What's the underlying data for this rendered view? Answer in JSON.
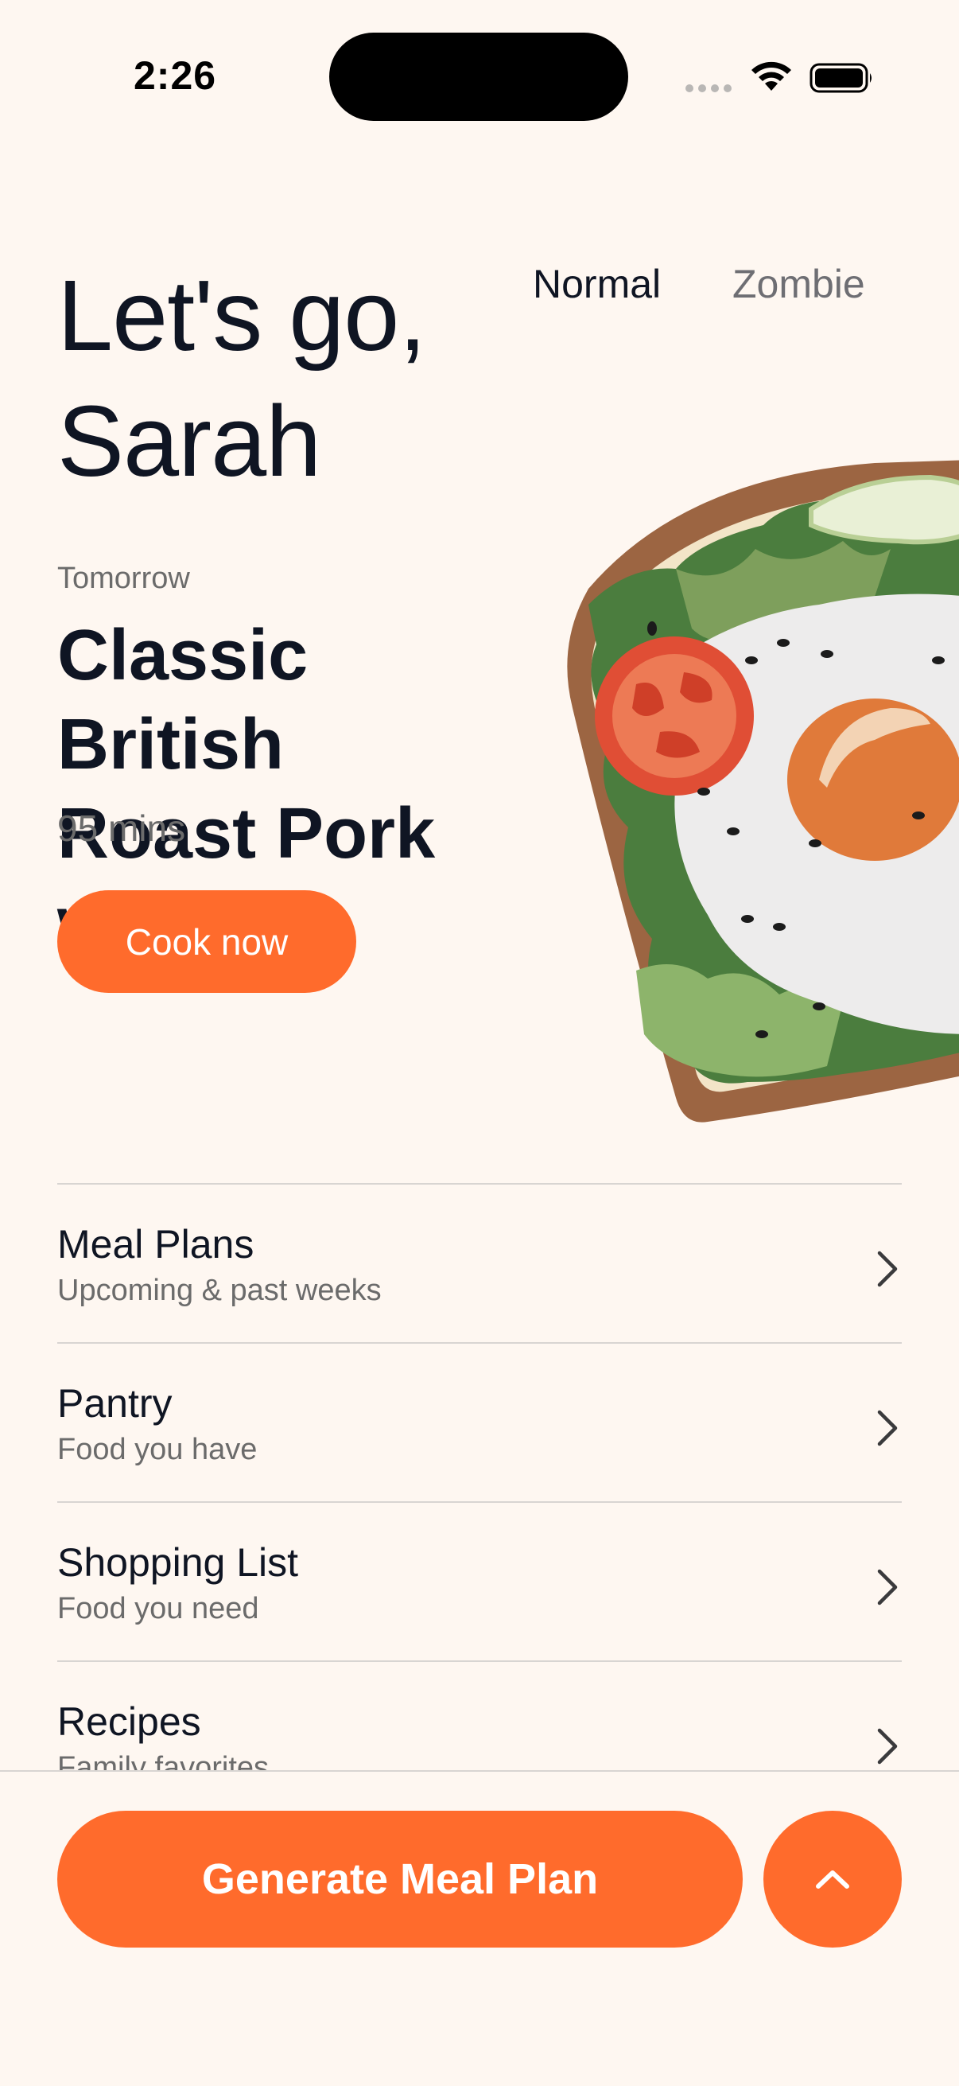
{
  "status_bar": {
    "time": "2:26"
  },
  "header": {
    "greeting_line1": "Let's go,",
    "greeting_line2": "Sarah",
    "mode_options": [
      "Normal",
      "Zombie"
    ],
    "selected_mode": "Normal"
  },
  "next_meal": {
    "when": "Tomorrow",
    "title_line1": "Classic British",
    "title_line2": "Roast Pork w…",
    "duration": "95 mins",
    "cta_label": "Cook now"
  },
  "menu": {
    "items": [
      {
        "title": "Meal Plans",
        "subtitle": "Upcoming & past weeks"
      },
      {
        "title": "Pantry",
        "subtitle": "Food you have"
      },
      {
        "title": "Shopping List",
        "subtitle": "Food you need"
      },
      {
        "title": "Recipes",
        "subtitle": "Family favorites"
      }
    ]
  },
  "bottom_bar": {
    "generate_label": "Generate Meal Plan",
    "expand_icon": "chevron-up-icon"
  },
  "colors": {
    "background": "#FEF7F1",
    "accent": "#FF6B2C",
    "text_primary": "#0F1523",
    "text_secondary": "#6B6B6B",
    "divider": "#D8D5D2"
  }
}
